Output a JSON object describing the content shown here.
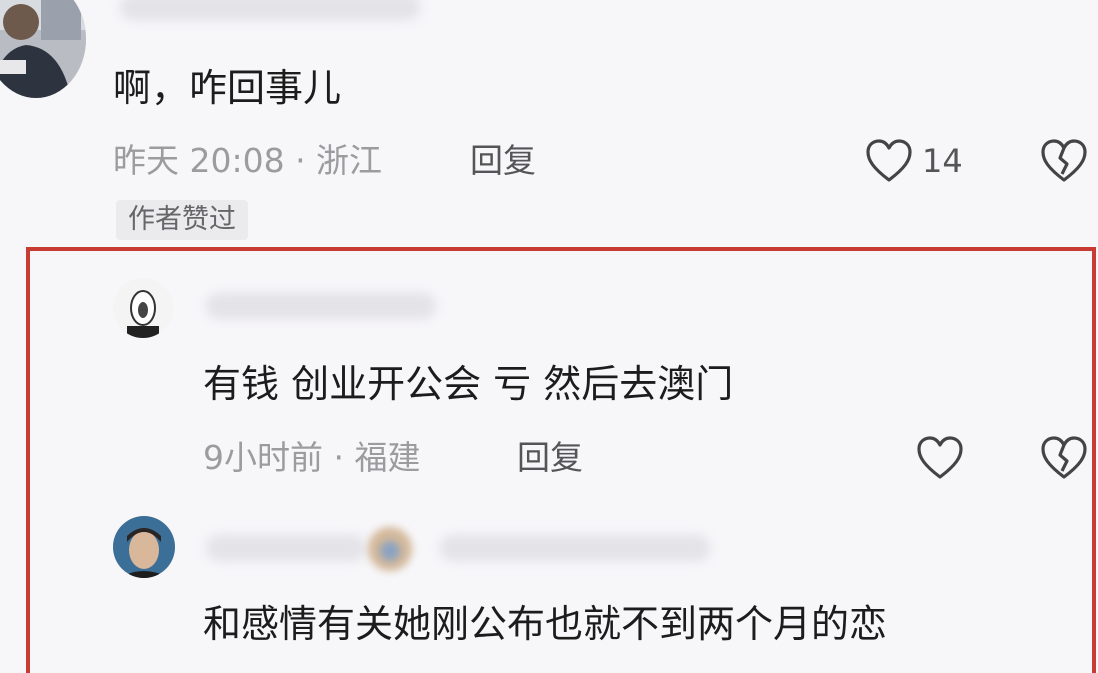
{
  "comments": {
    "main": {
      "text": "啊，咋回事儿",
      "meta": "昨天 20:08 · 浙江",
      "reply_label": "回复",
      "like_count": "14",
      "badge": "作者赞过"
    },
    "reply1": {
      "text": "有钱 创业开公会 亏 然后去澳门",
      "meta": "9小时前 · 福建",
      "reply_label": "回复"
    },
    "reply2": {
      "text": "和感情有关她刚公布也就不到两个月的恋"
    }
  },
  "colors": {
    "highlight_frame": "#c83b33",
    "meta_text": "#9c9c9f",
    "background": "#f7f6f9"
  },
  "icons": {
    "like": "heart-outline-icon",
    "dislike": "broken-heart-icon"
  }
}
